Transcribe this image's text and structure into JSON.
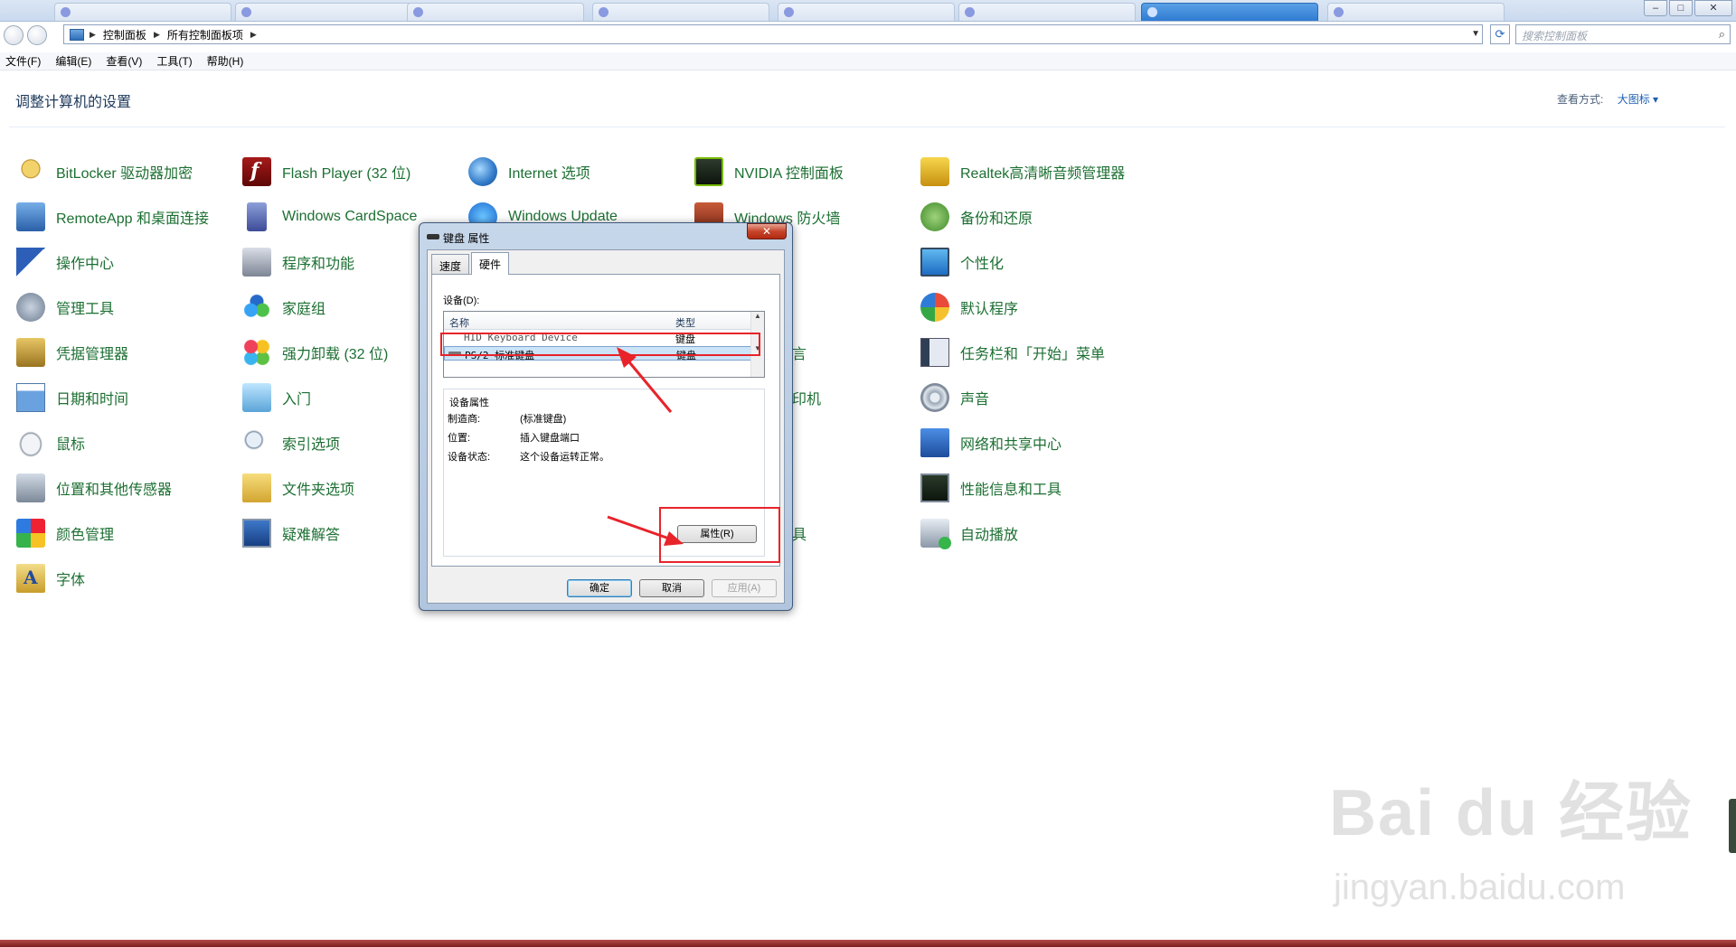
{
  "browser": {
    "tabs": [
      "",
      "",
      "",
      "",
      "",
      "",
      "",
      "",
      "",
      ""
    ],
    "window_buttons": {
      "min": "–",
      "max": "□",
      "close": "✕"
    }
  },
  "address": {
    "crumbs": [
      "控制面板",
      "所有控制面板项"
    ],
    "search_placeholder": "搜索控制面板"
  },
  "menu": [
    "文件(F)",
    "编辑(E)",
    "查看(V)",
    "工具(T)",
    "帮助(H)"
  ],
  "header": {
    "title": "调整计算机的设置",
    "view_by_label": "查看方式:",
    "view_by_value": "大图标 ▾"
  },
  "items": [
    {
      "label": "BitLocker 驱动器加密",
      "icon": "bitlocker-icon"
    },
    {
      "label": "Flash Player (32 位)",
      "icon": "flash-icon"
    },
    {
      "label": "Internet 选项",
      "icon": "internet-options-icon"
    },
    {
      "label": "NVIDIA 控制面板",
      "icon": "nvidia-icon"
    },
    {
      "label": "Realtek高清晰音频管理器",
      "icon": "realtek-icon"
    },
    {
      "label": "RemoteApp 和桌面连接",
      "icon": "remoteapp-icon"
    },
    {
      "label": "Windows CardSpace",
      "icon": "cardspace-icon"
    },
    {
      "label": "Windows Update",
      "icon": "windows-update-icon"
    },
    {
      "label": "Windows 防火墙",
      "icon": "firewall-icon"
    },
    {
      "label": "备份和还原",
      "icon": "backup-icon"
    },
    {
      "label": "操作中心",
      "icon": "action-center-flag-icon"
    },
    {
      "label": "程序和功能",
      "icon": "programs-icon"
    },
    {
      "label": "个性化",
      "icon": "personalization-icon"
    },
    {
      "label": "管理工具",
      "icon": "admin-tools-icon"
    },
    {
      "label": "家庭组",
      "icon": "homegroup-icon"
    },
    {
      "label": "默认程序",
      "icon": "default-programs-icon"
    },
    {
      "label": "凭据管理器",
      "icon": "credential-manager-icon"
    },
    {
      "label": "强力卸载 (32 位)",
      "icon": "uninstaller-icon"
    },
    {
      "label": "言",
      "icon": ""
    },
    {
      "label": "任务栏和「开始」菜单",
      "icon": "taskbar-icon"
    },
    {
      "label": "日期和时间",
      "icon": "date-time-icon"
    },
    {
      "label": "入门",
      "icon": "getting-started-icon"
    },
    {
      "label": "印机",
      "icon": ""
    },
    {
      "label": "声音",
      "icon": "sound-icon"
    },
    {
      "label": "鼠标",
      "icon": "mouse-icon"
    },
    {
      "label": "索引选项",
      "icon": "indexing-icon"
    },
    {
      "label": "网络和共享中心",
      "icon": "network-icon"
    },
    {
      "label": "位置和其他传感器",
      "icon": "location-icon"
    },
    {
      "label": "文件夹选项",
      "icon": "folder-options-icon"
    },
    {
      "label": "性能信息和工具",
      "icon": "performance-icon"
    },
    {
      "label": "颜色管理",
      "icon": "color-management-icon"
    },
    {
      "label": "疑难解答",
      "icon": "troubleshooting-icon"
    },
    {
      "label": "具",
      "icon": ""
    },
    {
      "label": "自动播放",
      "icon": "autoplay-icon"
    },
    {
      "label": "字体",
      "icon": "fonts-icon"
    }
  ],
  "dialog": {
    "title": "键盘 属性",
    "close": "✕",
    "tabs": [
      "速度",
      "硬件"
    ],
    "devices_label": "设备(D):",
    "columns": [
      "名称",
      "类型"
    ],
    "devices": [
      {
        "name": "HID Keyboard Device",
        "type": "键盘"
      },
      {
        "name": "PS/2 标准键盘",
        "type": "键盘"
      }
    ],
    "props_title": "设备属性",
    "props": [
      {
        "k": "制造商:",
        "v": "(标准键盘)"
      },
      {
        "k": "位置:",
        "v": "插入键盘端口"
      },
      {
        "k": "设备状态:",
        "v": "这个设备运转正常。"
      }
    ],
    "properties_button": "属性(R)",
    "ok": "确定",
    "cancel": "取消",
    "apply": "应用(A)"
  },
  "watermark": {
    "brand": "Bai du 经验",
    "url": "jingyan.baidu.com"
  },
  "colors": {
    "link_green": "#1c6f32",
    "annotation_red": "#e8232a"
  }
}
